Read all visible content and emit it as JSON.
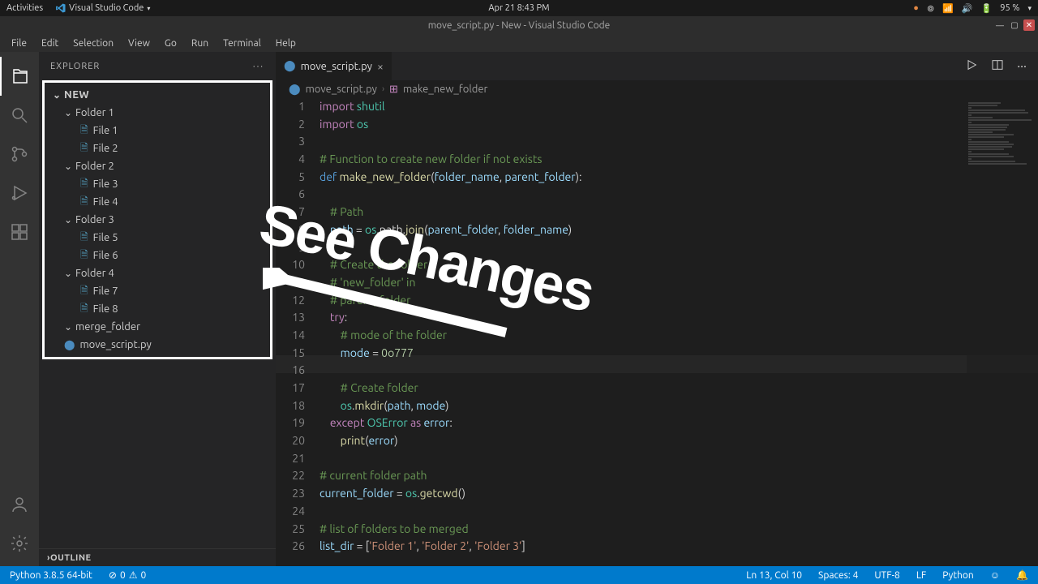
{
  "system_bar": {
    "activities": "Activities",
    "app_menu": "Visual Studio Code",
    "datetime": "Apr 21  8:43 PM",
    "battery": "95 %"
  },
  "title_bar": {
    "title": "move_script.py - New - Visual Studio Code"
  },
  "menu": {
    "file": "File",
    "edit": "Edit",
    "selection": "Selection",
    "view": "View",
    "go": "Go",
    "run": "Run",
    "terminal": "Terminal",
    "help": "Help"
  },
  "sidebar": {
    "title": "EXPLORER",
    "root": "NEW",
    "folders": [
      {
        "name": "Folder 1",
        "files": [
          "File 1",
          "File 2"
        ]
      },
      {
        "name": "Folder 2",
        "files": [
          "File 3",
          "File 4"
        ]
      },
      {
        "name": "Folder 3",
        "files": [
          "File 5",
          "File 6"
        ]
      },
      {
        "name": "Folder 4",
        "files": [
          "File 7",
          "File 8"
        ]
      },
      {
        "name": "merge_folder",
        "files": []
      }
    ],
    "root_files": [
      "move_script.py"
    ],
    "outline": "OUTLINE"
  },
  "tabs": {
    "active": "move_script.py"
  },
  "breadcrumb": {
    "file": "move_script.py",
    "symbol": "make_new_folder"
  },
  "code": {
    "lines": [
      {
        "n": 1,
        "tokens": [
          [
            "kw",
            "import"
          ],
          [
            "",
            " "
          ],
          [
            "mod",
            "shutil"
          ]
        ]
      },
      {
        "n": 2,
        "tokens": [
          [
            "kw",
            "import"
          ],
          [
            "",
            " "
          ],
          [
            "mod",
            "os"
          ]
        ]
      },
      {
        "n": 3,
        "tokens": [
          [
            "",
            ""
          ]
        ]
      },
      {
        "n": 4,
        "tokens": [
          [
            "cmt",
            "# Function to create new folder if not exists"
          ]
        ]
      },
      {
        "n": 5,
        "tokens": [
          [
            "decl",
            "def"
          ],
          [
            "",
            " "
          ],
          [
            "fn",
            "make_new_folder"
          ],
          [
            "",
            "("
          ],
          [
            "var",
            "folder_name"
          ],
          [
            "",
            ", "
          ],
          [
            "var",
            "parent_folder"
          ],
          [
            "",
            "):"
          ]
        ]
      },
      {
        "n": 6,
        "tokens": [
          [
            "",
            ""
          ]
        ]
      },
      {
        "n": 7,
        "tokens": [
          [
            "",
            "    "
          ],
          [
            "cmt",
            "# Path"
          ]
        ]
      },
      {
        "n": 8,
        "tokens": [
          [
            "",
            "    "
          ],
          [
            "var",
            "path"
          ],
          [
            "",
            " = "
          ],
          [
            "mod",
            "os"
          ],
          [
            "",
            ".path."
          ],
          [
            "fn",
            "join"
          ],
          [
            "",
            "("
          ],
          [
            "var",
            "parent_folder"
          ],
          [
            "",
            ", "
          ],
          [
            "var",
            "folder_name"
          ],
          [
            "",
            ")"
          ]
        ]
      },
      {
        "n": 9,
        "tokens": [
          [
            "",
            ""
          ]
        ]
      },
      {
        "n": 10,
        "tokens": [
          [
            "",
            "    "
          ],
          [
            "cmt",
            "# Create the folder"
          ]
        ]
      },
      {
        "n": 11,
        "tokens": [
          [
            "",
            "    "
          ],
          [
            "cmt",
            "# 'new_folder' in"
          ]
        ]
      },
      {
        "n": 12,
        "tokens": [
          [
            "",
            "    "
          ],
          [
            "cmt",
            "# parent_folder"
          ]
        ]
      },
      {
        "n": 13,
        "tokens": [
          [
            "",
            "    "
          ],
          [
            "kw",
            "try"
          ],
          [
            "",
            ":"
          ]
        ]
      },
      {
        "n": 14,
        "tokens": [
          [
            "",
            "        "
          ],
          [
            "cmt",
            "# mode of the folder"
          ]
        ]
      },
      {
        "n": 15,
        "tokens": [
          [
            "",
            "        "
          ],
          [
            "var",
            "mode"
          ],
          [
            "",
            " = "
          ],
          [
            "num",
            "0o777"
          ]
        ]
      },
      {
        "n": 16,
        "tokens": [
          [
            "",
            ""
          ]
        ]
      },
      {
        "n": 17,
        "tokens": [
          [
            "",
            "        "
          ],
          [
            "cmt",
            "# Create folder"
          ]
        ]
      },
      {
        "n": 18,
        "tokens": [
          [
            "",
            "        "
          ],
          [
            "mod",
            "os"
          ],
          [
            "",
            "."
          ],
          [
            "fn",
            "mkdir"
          ],
          [
            "",
            "("
          ],
          [
            "var",
            "path"
          ],
          [
            "",
            ", "
          ],
          [
            "var",
            "mode"
          ],
          [
            "",
            ")"
          ]
        ]
      },
      {
        "n": 19,
        "tokens": [
          [
            "",
            "    "
          ],
          [
            "kw",
            "except"
          ],
          [
            "",
            " "
          ],
          [
            "cls",
            "OSError"
          ],
          [
            "",
            " "
          ],
          [
            "kw",
            "as"
          ],
          [
            "",
            " "
          ],
          [
            "var",
            "error"
          ],
          [
            "",
            ":"
          ]
        ]
      },
      {
        "n": 20,
        "tokens": [
          [
            "",
            "        "
          ],
          [
            "fn",
            "print"
          ],
          [
            "",
            "("
          ],
          [
            "var",
            "error"
          ],
          [
            "",
            ")"
          ]
        ]
      },
      {
        "n": 21,
        "tokens": [
          [
            "",
            ""
          ]
        ]
      },
      {
        "n": 22,
        "tokens": [
          [
            "cmt",
            "# current folder path"
          ]
        ]
      },
      {
        "n": 23,
        "tokens": [
          [
            "var",
            "current_folder"
          ],
          [
            "",
            " = "
          ],
          [
            "mod",
            "os"
          ],
          [
            "",
            "."
          ],
          [
            "fn",
            "getcwd"
          ],
          [
            "",
            "()"
          ]
        ]
      },
      {
        "n": 24,
        "tokens": [
          [
            "",
            ""
          ]
        ]
      },
      {
        "n": 25,
        "tokens": [
          [
            "cmt",
            "# list of folders to be merged"
          ]
        ]
      },
      {
        "n": 26,
        "tokens": [
          [
            "var",
            "list_dir"
          ],
          [
            "",
            " = ["
          ],
          [
            "str",
            "'Folder 1'"
          ],
          [
            "",
            ", "
          ],
          [
            "str",
            "'Folder 2'"
          ],
          [
            "",
            ", "
          ],
          [
            "str",
            "'Folder 3'"
          ],
          [
            "",
            "]"
          ]
        ]
      }
    ]
  },
  "status": {
    "python_version": "Python 3.8.5 64-bit",
    "errors": "0",
    "warnings": "0",
    "cursor": "Ln 13, Col 10",
    "spaces": "Spaces: 4",
    "encoding": "UTF-8",
    "eol": "LF",
    "lang": "Python"
  },
  "annotation": {
    "text": "See Changes"
  }
}
